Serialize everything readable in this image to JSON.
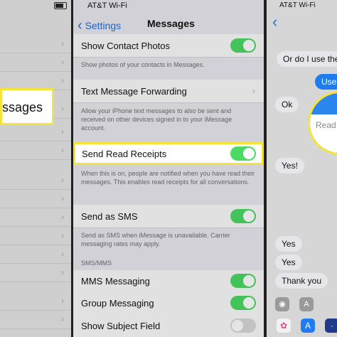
{
  "left": {
    "callout_text": "ssages",
    "row_chevron": "›"
  },
  "middle": {
    "status": {
      "carrier": "AT&T Wi-Fi",
      "time": ""
    },
    "nav": {
      "back_label": "Settings",
      "back_arrow": "‹",
      "title": "Messages"
    },
    "rows": {
      "contact_photos": "Show Contact Photos",
      "contact_photos_note": "Show photos of your contacts in Messages.",
      "forwarding": "Text Message Forwarding",
      "forwarding_note": "Allow your iPhone text messages to also be sent and received on other devices signed in to your iMessage account.",
      "read_receipts": "Send Read Receipts",
      "read_receipts_note": "When this is on, people are notified when you have read their messages. This enables read receipts for all conversations.",
      "send_sms": "Send as SMS",
      "send_sms_note": "Send as SMS when iMessage is unavailable. Carrier messaging rates may apply.",
      "section_mms": "SMS/MMS",
      "mms": "MMS Messaging",
      "group": "Group Messaging",
      "subject": "Show Subject Field"
    },
    "chevron": "›"
  },
  "right": {
    "status": {
      "carrier": "AT&T Wi-Fi"
    },
    "nav": {
      "back_arrow": "‹"
    },
    "messages": {
      "m1": "Or do I use the",
      "m2": "Use",
      "m3": "Ok",
      "m4": "Yes!",
      "m5": "Yes",
      "m6": "Yes",
      "m7": "Thank you"
    },
    "zoom_text": "Read"
  },
  "colors": {
    "accent": "#1f6fd6",
    "toggle_on": "#4cd964",
    "highlight": "#f4e43a"
  }
}
